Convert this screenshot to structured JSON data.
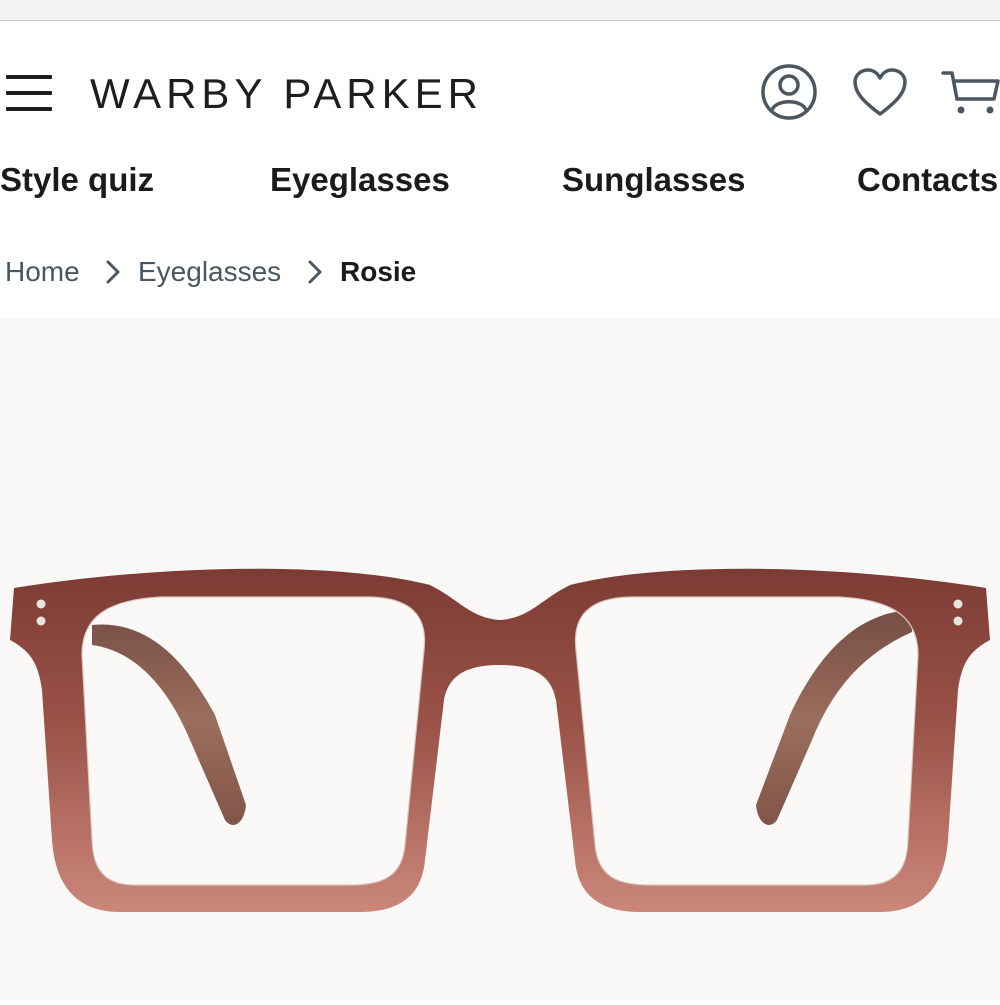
{
  "brand": {
    "logo_text": "WARBY PARKER"
  },
  "header_icons": [
    "menu-icon",
    "account-icon",
    "heart-icon",
    "cart-icon"
  ],
  "nav": {
    "items": [
      {
        "label": "Style quiz"
      },
      {
        "label": "Eyeglasses"
      },
      {
        "label": "Sunglasses"
      },
      {
        "label": "Contacts"
      }
    ]
  },
  "breadcrumb": {
    "items": [
      {
        "label": "Home"
      },
      {
        "label": "Eyeglasses"
      },
      {
        "label": "Rosie"
      }
    ],
    "separator_icon": "chevron-right-icon"
  },
  "product": {
    "image_subject": "eyeglasses",
    "colors": {
      "frame_top": "#7b3b34",
      "frame_bottom": "#c98377",
      "temple": "#6b3a2a",
      "background": "#f9f8f7"
    }
  }
}
